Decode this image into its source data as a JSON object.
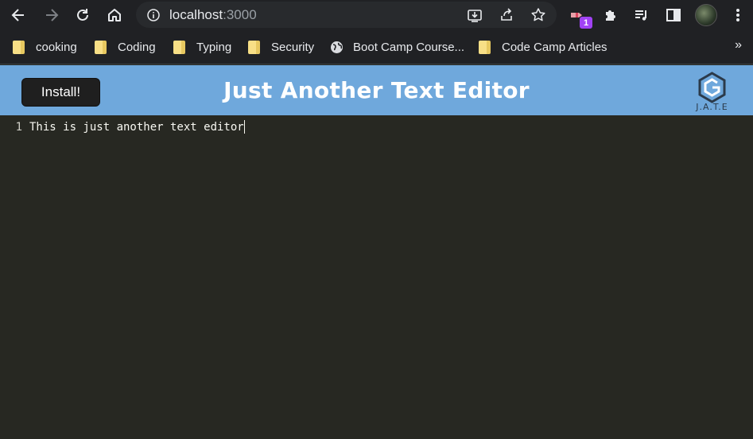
{
  "browser": {
    "url_host": "localhost",
    "url_port": ":3000",
    "extension_badge": "1"
  },
  "bookmarks": [
    {
      "label": "cooking",
      "icon": "folder-icon"
    },
    {
      "label": "Coding",
      "icon": "folder-icon"
    },
    {
      "label": "Typing",
      "icon": "folder-icon"
    },
    {
      "label": "Security",
      "icon": "folder-icon"
    },
    {
      "label": "Boot Camp Course...",
      "icon": "globe-icon"
    },
    {
      "label": "Code Camp Articles",
      "icon": "folder-icon"
    }
  ],
  "bookmarks_more": "»",
  "header": {
    "install_label": "Install!",
    "title": "Just Another Text Editor",
    "logo_text": "J.A.T.E",
    "background": "#6fa8dc"
  },
  "editor": {
    "lines": [
      {
        "number": "1",
        "text": "This is just another text editor"
      }
    ],
    "background": "#272822"
  }
}
